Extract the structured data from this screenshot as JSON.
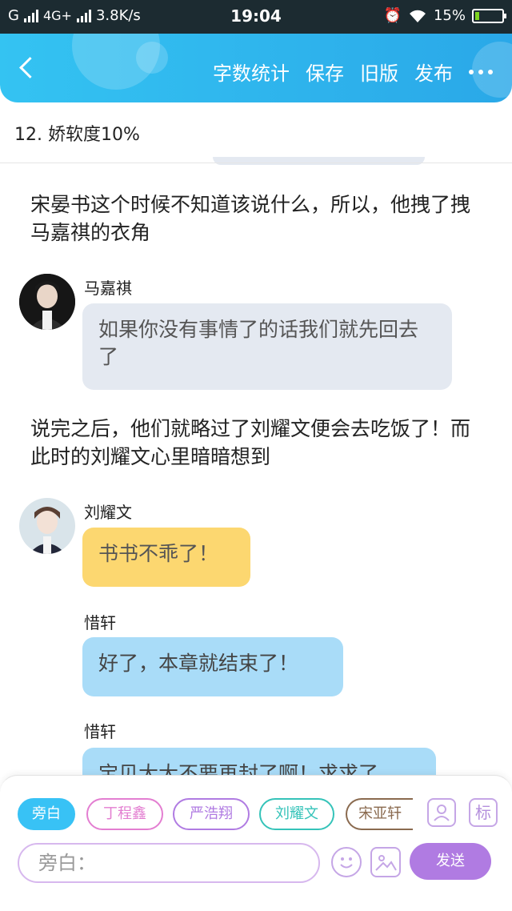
{
  "status_bar": {
    "carrier": "G",
    "network": "4G+",
    "speed": "3.8K/s",
    "time": "19:04",
    "battery": "15%",
    "battery_level": 0.15
  },
  "header": {
    "actions": [
      "字数统计",
      "保存",
      "旧版",
      "发布"
    ]
  },
  "chapter": {
    "title": "12. 娇软度10%"
  },
  "content": {
    "narration_1": "宋晏书这个时候不知道该说什么，所以，他拽了拽马嘉祺的衣角",
    "message_1": {
      "speaker": "马嘉祺",
      "text": "如果你没有事情了的话我们就先回去了"
    },
    "narration_2": "说完之后，他们就略过了刘耀文便会去吃饭了！而此时的刘耀文心里暗暗想到",
    "message_2": {
      "speaker": "刘耀文",
      "text": "书书不乖了！"
    },
    "message_3": {
      "speaker": "惜轩",
      "text": "好了，本章就结束了！"
    },
    "message_4": {
      "speaker": "惜轩",
      "text": "宝贝大大不要再封了啊！求求了"
    }
  },
  "composer": {
    "chips": [
      "旁白",
      "丁程鑫",
      "严浩翔",
      "刘耀文",
      "宋亚轩"
    ],
    "mark_label": "标",
    "input_placeholder": "旁白：",
    "send_label": "发送"
  },
  "colors": {
    "accent_blue": "#34c3f2",
    "send_purple": "#b07be2",
    "bubble_gray": "#e4e9f1",
    "bubble_yellow": "#fcd770",
    "bubble_blue": "#a9dcf8"
  }
}
